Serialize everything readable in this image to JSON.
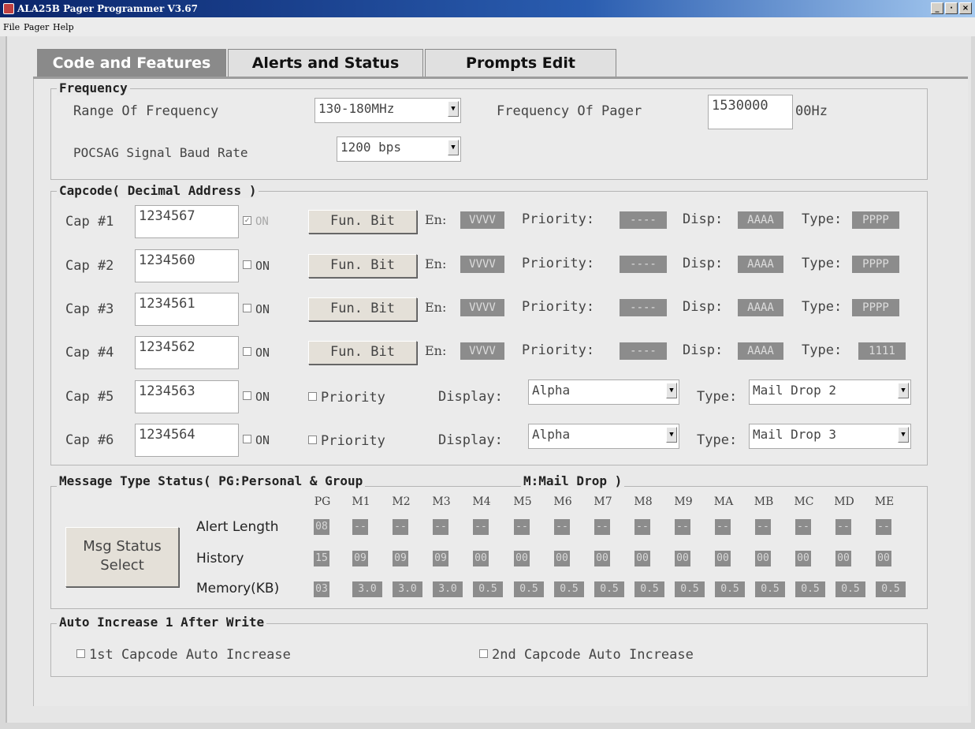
{
  "window": {
    "title": "ALA25B Pager Programmer V3.67",
    "controls": [
      "_",
      "·",
      "×"
    ]
  },
  "menu": [
    "File",
    "Pager",
    "Help"
  ],
  "tabs": [
    "Code and Features",
    "Alerts and Status",
    "Prompts Edit"
  ],
  "frequency": {
    "title": "Frequency",
    "range_label": "Range Of Frequency",
    "range_value": "130-180MHz",
    "pager_label": "Frequency Of Pager",
    "pager_value": "1530000",
    "pager_unit": "00Hz",
    "baud_label": "POCSAG Signal Baud Rate",
    "baud_value": "1200 bps"
  },
  "capcode": {
    "title": "Capcode( Decimal Address )",
    "on_label": "ON",
    "funbit_label": "Fun. Bit",
    "en_label": "En:",
    "priority_label": "Priority:",
    "disp_label": "Disp:",
    "type_label": "Type:",
    "priority_check_label": "Priority",
    "display_label": "Display:",
    "rows": [
      {
        "label": "Cap #1",
        "code": "1234567",
        "en": "VVVV",
        "priority": "----",
        "disp": "AAAA",
        "type": "PPPP"
      },
      {
        "label": "Cap #2",
        "code": "1234560",
        "en": "VVVV",
        "priority": "----",
        "disp": "AAAA",
        "type": "PPPP"
      },
      {
        "label": "Cap #3",
        "code": "1234561",
        "en": "VVVV",
        "priority": "----",
        "disp": "AAAA",
        "type": "PPPP"
      },
      {
        "label": "Cap #4",
        "code": "1234562",
        "en": "VVVV",
        "priority": "----",
        "disp": "AAAA",
        "type": "1111"
      },
      {
        "label": "Cap #5",
        "code": "1234563",
        "display": "Alpha",
        "type": "Mail Drop 2"
      },
      {
        "label": "Cap #6",
        "code": "1234564",
        "display": "Alpha",
        "type": "Mail Drop 3"
      }
    ]
  },
  "msgstatus": {
    "title": "Message Type Status( PG:Personal & Group",
    "title2": "M:Mail Drop )",
    "button": "Msg Status Select",
    "columns": [
      "PG",
      "M1",
      "M2",
      "M3",
      "M4",
      "M5",
      "M6",
      "M7",
      "M8",
      "M9",
      "MA",
      "MB",
      "MC",
      "MD",
      "ME"
    ],
    "rows": [
      {
        "label": "Alert Length",
        "values": [
          "08",
          "--",
          "--",
          "--",
          "--",
          "--",
          "--",
          "--",
          "--",
          "--",
          "--",
          "--",
          "--",
          "--",
          "--"
        ]
      },
      {
        "label": "History",
        "values": [
          "15",
          "09",
          "09",
          "09",
          "00",
          "00",
          "00",
          "00",
          "00",
          "00",
          "00",
          "00",
          "00",
          "00",
          "00"
        ]
      },
      {
        "label": "Memory(KB)",
        "values": [
          "03",
          "3.0",
          "3.0",
          "3.0",
          "0.5",
          "0.5",
          "0.5",
          "0.5",
          "0.5",
          "0.5",
          "0.5",
          "0.5",
          "0.5",
          "0.5",
          "0.5"
        ]
      }
    ]
  },
  "autoinc": {
    "title": "Auto Increase 1 After Write",
    "first": "1st Capcode Auto Increase",
    "second": "2nd Capcode Auto Increase"
  }
}
